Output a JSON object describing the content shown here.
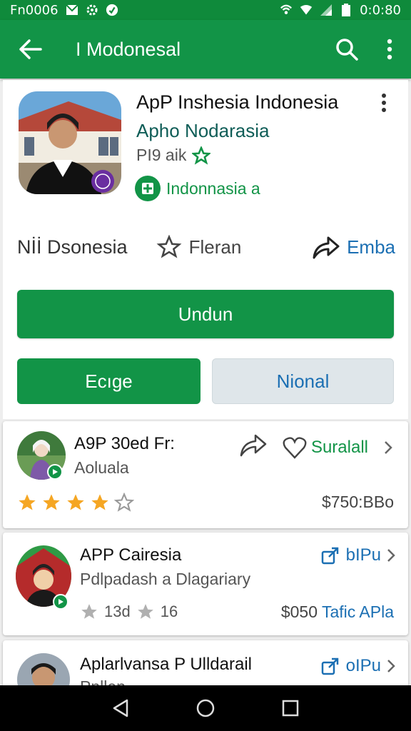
{
  "status_bar": {
    "time_left": "Fn0006",
    "time_right": "0:0:80"
  },
  "app_bar": {
    "title": "I Modonesal"
  },
  "app": {
    "name": "ApP Inshesia Indonesia",
    "subname": "Apho Nodarasia",
    "developer": "PI9 aik",
    "category": "Indonnasia a"
  },
  "actions": {
    "first": "Nİİ Dsonesia",
    "wishlist": "Fleran",
    "share": "Emba"
  },
  "buttons": {
    "install": "Undun",
    "secondary_left": "Ecıge",
    "secondary_right": "Nional"
  },
  "cards": [
    {
      "title": "A9P 30ed Fr:",
      "subtitle": "Aoluala",
      "action_label": "Suralall",
      "rating_stars": 4,
      "price": "$750:BBo"
    },
    {
      "title": "APP Cairesia",
      "subtitle": "Pdlpadash a Dlagariary",
      "action_label": "bIPu",
      "stat1": "13d",
      "stat2": "16",
      "price_prefix": "$050",
      "price_text": "Tafic APla"
    },
    {
      "title": "Aplarlvansa P Ulldarail",
      "subtitle": "Pnllen",
      "action_label": "oIPu"
    }
  ],
  "colors": {
    "primary": "#129447",
    "accent_blue": "#1b6fb3",
    "status_bar": "#0f8a3b"
  }
}
